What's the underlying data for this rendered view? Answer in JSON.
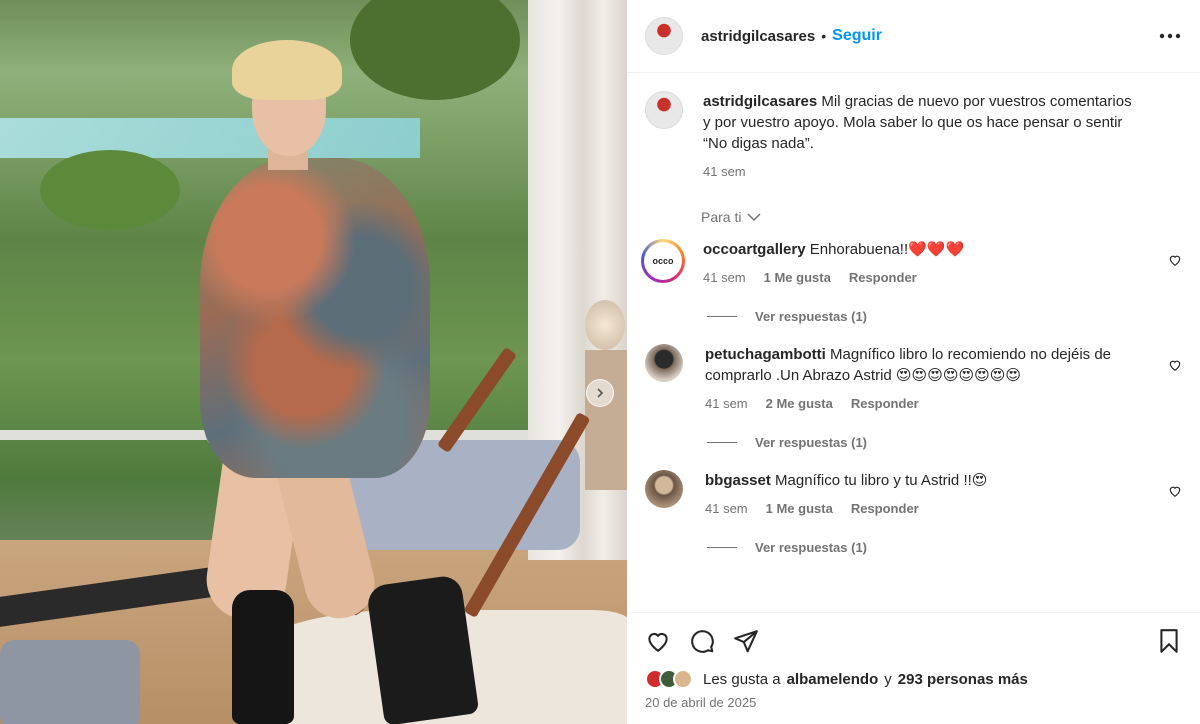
{
  "post": {
    "username": "astridgilcasares",
    "follow_label": "Seguir",
    "separator": "•"
  },
  "caption": {
    "username": "astridgilcasares",
    "text": "Mil gracias de nuevo por vuestros comentarios y por vuestro apoyo. Mola saber lo que os hace pensar o sentir “No digas nada”.",
    "time": "41 sem"
  },
  "for_you": "Para ti",
  "comments": [
    {
      "username": "occoartgallery",
      "text": "Enhorabuena!!❤️❤️❤️",
      "time": "41 sem",
      "likes": "1 Me gusta",
      "reply": "Responder",
      "view_replies": "Ver respuestas (1)",
      "avatar_text": "occo"
    },
    {
      "username": "petuchagambotti",
      "text": "Magnífico libro lo recomiendo no dejéis de comprarlo .Un Abrazo Astrid 😍😍😍😍😍😍😍😍",
      "time": "41 sem",
      "likes": "2 Me gusta",
      "reply": "Responder",
      "view_replies": "Ver respuestas (1)"
    },
    {
      "username": "bbgasset",
      "text": "Magnífico tu libro y tu Astrid !!😍",
      "time": "41 sem",
      "likes": "1 Me gusta",
      "reply": "Responder",
      "view_replies": "Ver respuestas (1)"
    }
  ],
  "likes": {
    "prefix": "Les gusta a",
    "user": "albamelendo",
    "connector": "y",
    "others": "293 personas más"
  },
  "date": "20 de abril de 2025",
  "icons": {
    "more": "more-horizontal-icon",
    "like": "heart-icon",
    "comment": "comment-icon",
    "share": "share-icon",
    "save": "bookmark-icon",
    "next": "chevron-right-icon"
  }
}
